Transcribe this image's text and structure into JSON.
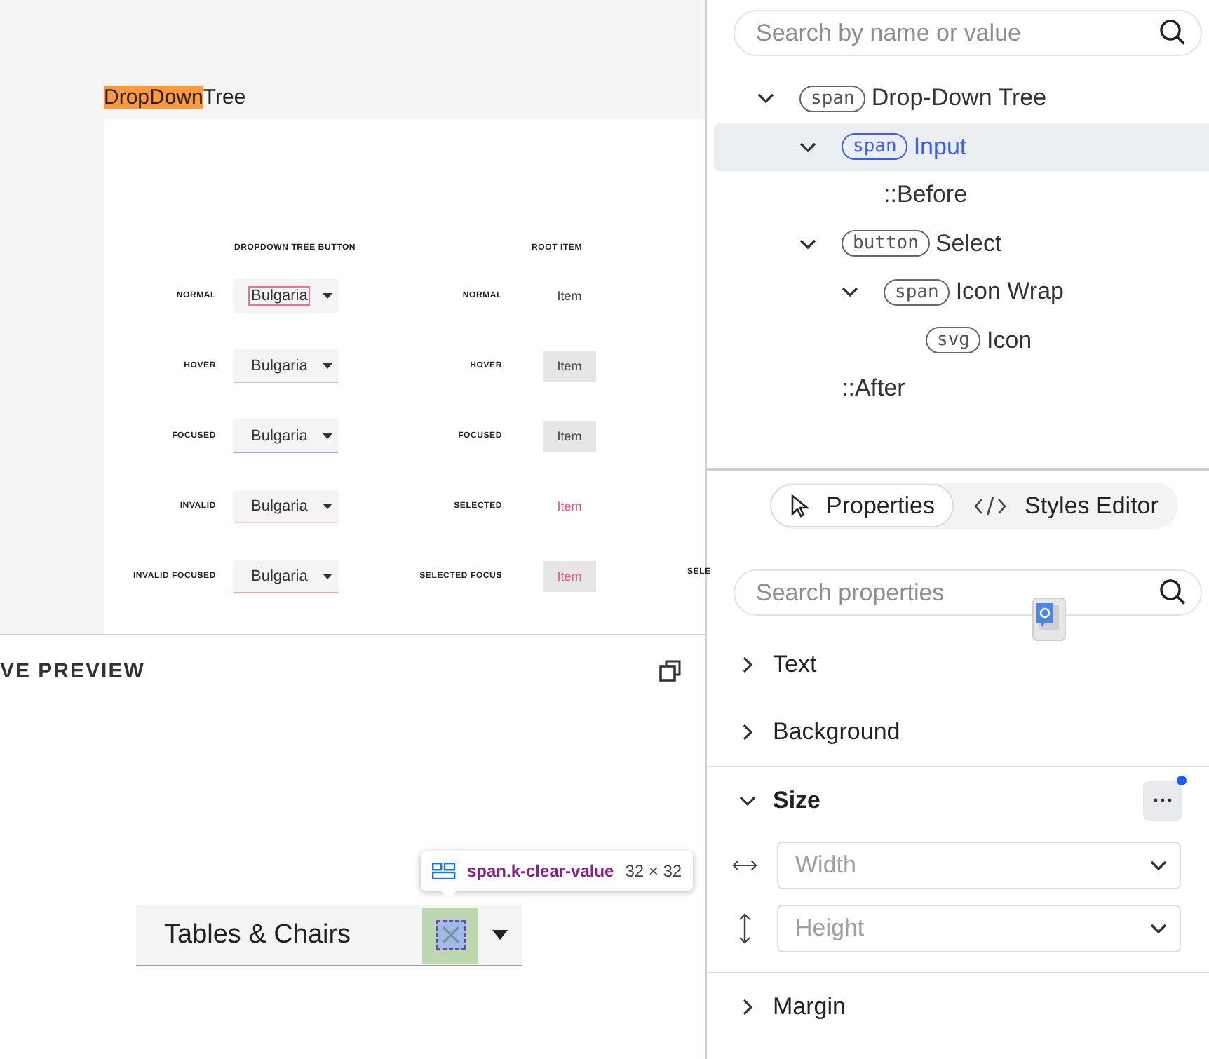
{
  "preview": {
    "title_highlight": "DropDown",
    "title_rest": "Tree",
    "button_column": {
      "header": "DROPDOWN TREE BUTTON",
      "rows": [
        {
          "label": "NORMAL",
          "value": "Bulgaria",
          "kind": "normal"
        },
        {
          "label": "HOVER",
          "value": "Bulgaria",
          "kind": "hover"
        },
        {
          "label": "FOCUSED",
          "value": "Bulgaria",
          "kind": "focused"
        },
        {
          "label": "INVALID",
          "value": "Bulgaria",
          "kind": "invalid"
        },
        {
          "label": "INVALID FOCUSED",
          "value": "Bulgaria",
          "kind": "invalid-focused"
        }
      ]
    },
    "item_column": {
      "header": "ROOT ITEM",
      "rows": [
        {
          "label": "NORMAL",
          "text": "Item",
          "selected": false,
          "highlighted": false
        },
        {
          "label": "HOVER",
          "text": "Item",
          "selected": false,
          "highlighted": true
        },
        {
          "label": "FOCUSED",
          "text": "Item",
          "selected": false,
          "highlighted": true
        },
        {
          "label": "SELECTED",
          "text": "Item",
          "selected": true,
          "highlighted": false
        },
        {
          "label": "SELECTED FOCUS",
          "text": "Item",
          "selected": true,
          "highlighted": true
        }
      ]
    },
    "cut_label": "SELE"
  },
  "live_preview": {
    "title": "VE PREVIEW",
    "dropdown": {
      "value": "Tables & Chairs"
    },
    "tooltip": {
      "selector": "span.k-clear-value",
      "size": "32 × 32"
    }
  },
  "inspector": {
    "search": {
      "placeholder": "Search by name or value"
    },
    "tree": [
      {
        "tag": "span",
        "label": "Drop-Down Tree",
        "expanded": true,
        "selected": false,
        "children": [
          {
            "tag": "span",
            "label": "Input",
            "expanded": true,
            "selected": true,
            "children": [
              {
                "label": "::Before",
                "selected": false
              }
            ]
          },
          {
            "tag": "button",
            "label": "Select",
            "expanded": true,
            "selected": false,
            "children": [
              {
                "tag": "span",
                "label": "Icon Wrap",
                "expanded": true,
                "selected": false,
                "children": [
                  {
                    "tag": "svg",
                    "label": "Icon",
                    "selected": false
                  }
                ]
              }
            ]
          },
          {
            "label": "::After",
            "selected": false
          }
        ]
      }
    ]
  },
  "properties": {
    "tabs": [
      {
        "kind": "properties",
        "label": "Properties",
        "selected": true
      },
      {
        "kind": "styles",
        "label": "Styles Editor",
        "selected": false
      }
    ],
    "search": {
      "placeholder": "Search properties"
    },
    "sections": [
      {
        "label": "Text",
        "expanded": false
      },
      {
        "label": "Background",
        "expanded": false
      },
      {
        "label": "Size",
        "expanded": true,
        "has_changes": true,
        "fields": [
          {
            "kind": "width",
            "placeholder": "Width"
          },
          {
            "kind": "height",
            "placeholder": "Height"
          }
        ]
      },
      {
        "label": "Margin",
        "expanded": false
      }
    ]
  }
}
